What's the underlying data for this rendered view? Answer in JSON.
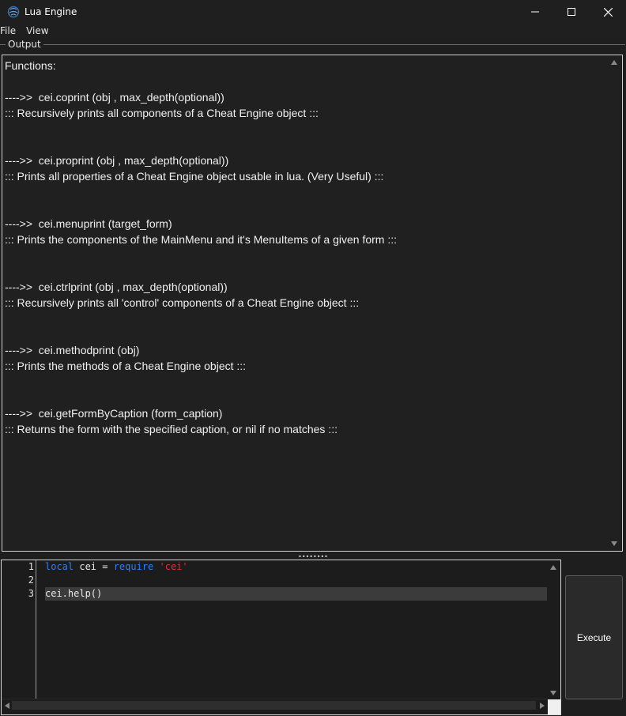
{
  "window": {
    "title": "Lua Engine",
    "icon": "cheat-engine-icon",
    "controls": [
      "minimize-icon",
      "maximize-icon",
      "close-icon"
    ]
  },
  "menu": {
    "items": [
      "File",
      "View"
    ]
  },
  "output_group": {
    "label": "Output",
    "lines": [
      "Functions:",
      "",
      "---->>  cei.coprint (obj , max_depth(optional))",
      "::: Recursively prints all components of a Cheat Engine object :::",
      "",
      "",
      "---->>  cei.proprint (obj , max_depth(optional))",
      "::: Prints all properties of a Cheat Engine object usable in lua. (Very Useful) :::",
      "",
      "",
      "---->>  cei.menuprint (target_form)",
      "::: Prints the components of the MainMenu and it's MenuItems of a given form :::",
      "",
      "",
      "---->>  cei.ctrlprint (obj , max_depth(optional))",
      "::: Recursively prints all 'control' components of a Cheat Engine object :::",
      "",
      "",
      "---->>  cei.methodprint (obj)",
      "::: Prints the methods of a Cheat Engine object :::",
      "",
      "",
      "---->>  cei.getFormByCaption (form_caption)",
      "::: Returns the form with the specified caption, or nil if no matches :::"
    ]
  },
  "editor": {
    "line_numbers": [
      "1",
      "2",
      "3"
    ],
    "current_line": 3,
    "code_lines": [
      [
        {
          "text": "local",
          "kind": "keyword"
        },
        {
          "text": " cei = ",
          "kind": "plain"
        },
        {
          "text": "require",
          "kind": "keyword"
        },
        {
          "text": " ",
          "kind": "plain"
        },
        {
          "text": "'cei'",
          "kind": "string"
        }
      ],
      [],
      [
        {
          "text": "cei.help",
          "kind": "plain"
        },
        {
          "text": "()",
          "kind": "plain"
        }
      ]
    ]
  },
  "execute_button": {
    "label": "Execute"
  },
  "colors": {
    "background": "#1e1e1e",
    "keyword": "#2f7ff0",
    "string": "#e0302a",
    "text": "#f0f0f0"
  }
}
